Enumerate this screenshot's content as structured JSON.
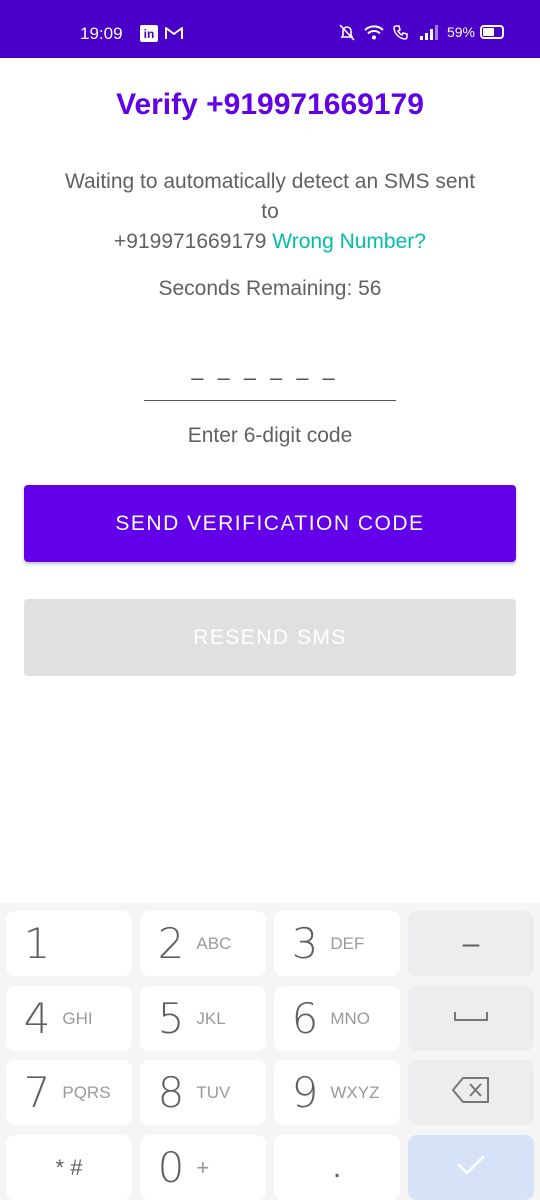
{
  "status_bar": {
    "time": "19:09",
    "battery_percent": "59%",
    "battery_level": 0.59,
    "icons": [
      "linkedin-icon",
      "gmail-icon",
      "mute-icon",
      "wifi-icon",
      "wifi-call-icon",
      "signal-icon",
      "battery-icon"
    ]
  },
  "header": {
    "title": "Verify +919971669179"
  },
  "body": {
    "wait_text_line1": "Waiting to automatically detect an SMS sent",
    "wait_text_line2": "to",
    "phone_number": "+919971669179",
    "wrong_number_link": "Wrong Number?",
    "seconds_remaining": "Seconds Remaining: 56",
    "code_placeholder": "––––––",
    "code_hint": "Enter 6-digit code"
  },
  "buttons": {
    "send_code": "SEND VERIFICATION CODE",
    "resend_sms": "RESEND SMS"
  },
  "keypad": {
    "keys": [
      {
        "digit": "1",
        "letters": ""
      },
      {
        "digit": "2",
        "letters": "ABC"
      },
      {
        "digit": "3",
        "letters": "DEF"
      },
      {
        "digit": "4",
        "letters": "GHI"
      },
      {
        "digit": "5",
        "letters": "JKL"
      },
      {
        "digit": "6",
        "letters": "MNO"
      },
      {
        "digit": "7",
        "letters": "PQRS"
      },
      {
        "digit": "8",
        "letters": "TUV"
      },
      {
        "digit": "9",
        "letters": "WXYZ"
      },
      {
        "digit": "0",
        "letters": "+"
      }
    ],
    "minus_label": "–",
    "star_hash_label": "* #",
    "dot_label": ".",
    "colors": {
      "background": "#f5f5f6",
      "key": "#ffffff",
      "done_key": "#d6e2f8"
    }
  },
  "colors": {
    "status_bar": "#4a00c9",
    "primary": "#6200ea",
    "link": "#00bfa5",
    "disabled_button": "#e0e0e0",
    "text": "#616161"
  }
}
